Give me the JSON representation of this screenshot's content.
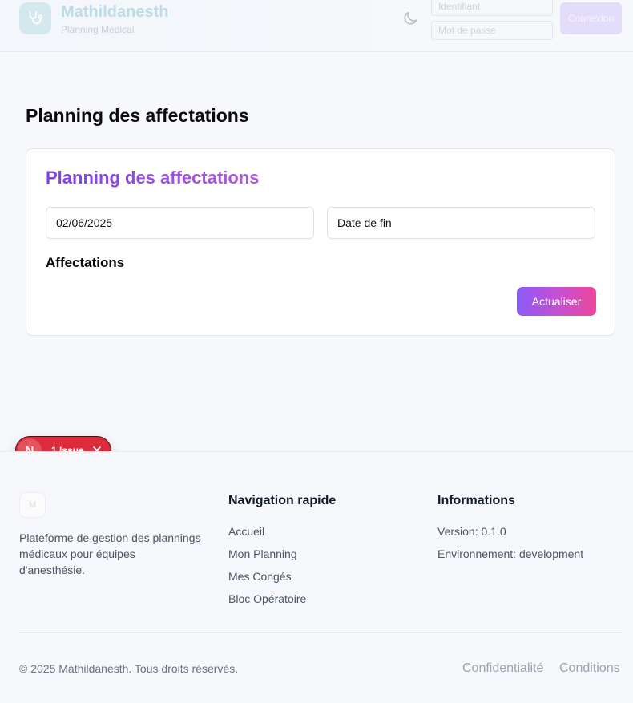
{
  "header": {
    "brand_name": "Mathildanesth",
    "brand_subtitle": "Planning Médical",
    "username_placeholder": "Identifiant",
    "password_placeholder": "Mot de passe",
    "login_label": "Connexion",
    "logo_icon": "stethoscope-icon",
    "theme_icon": "moon-icon"
  },
  "main": {
    "page_title": "Planning des affectations",
    "card_title": "Planning des affectations",
    "start_date_value": "02/06/2025",
    "end_date_placeholder": "Date de fin",
    "section_title": "Affectations",
    "refresh_label": "Actualiser"
  },
  "issue_badge": {
    "initial": "N",
    "label": "1 Issue"
  },
  "footer": {
    "logo_text": "M",
    "description": "Plateforme de gestion des plannings médicaux pour équipes d'anesthésie.",
    "nav_title": "Navigation rapide",
    "nav_links": [
      "Accueil",
      "Mon Planning",
      "Mes Congés",
      "Bloc Opératoire"
    ],
    "info_title": "Informations",
    "info_lines": [
      "Version: 0.1.0",
      "Environnement: development"
    ],
    "copyright": "© 2025 Mathildanesth. Tous droits réservés.",
    "legal_links": [
      "Confidentialité",
      "Conditions"
    ]
  },
  "colors": {
    "accent_gradient_start": "#8b5cf6",
    "accent_gradient_end": "#ec4899",
    "issue_red": "#dc2b3a"
  }
}
